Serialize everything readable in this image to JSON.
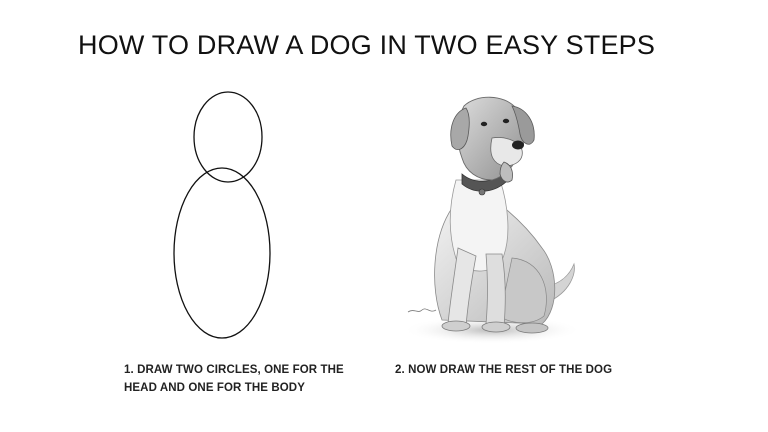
{
  "slide": {
    "title": "HOW TO DRAW A DOG IN TWO EASY STEPS",
    "step1": {
      "line1": "1. DRAW TWO CIRCLES, ONE FOR THE",
      "line2": "HEAD AND ONE FOR THE BODY"
    },
    "step2": {
      "text": "2. NOW DRAW THE REST OF THE DOG"
    },
    "illustration_left": "two-ovals-sketch",
    "illustration_right": "sitting-dog-pencil-drawing"
  }
}
